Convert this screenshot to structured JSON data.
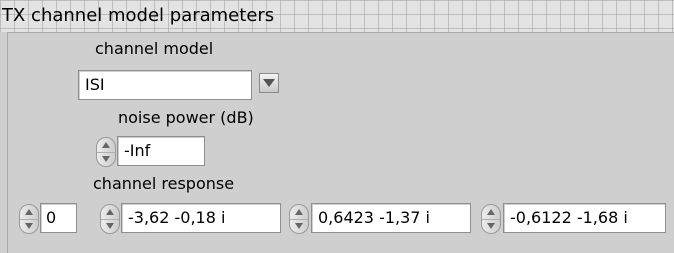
{
  "panel": {
    "title": "TX channel model parameters"
  },
  "channel_model": {
    "label": "channel model",
    "value": "ISI",
    "dropdown_icon": "triangle-down-icon"
  },
  "noise_power": {
    "label": "noise power (dB)",
    "value": "-Inf"
  },
  "channel_response": {
    "label": "channel response",
    "array_index": "0",
    "elements": [
      "-3,62 -0,18 i",
      "0,6423 -1,37 i",
      "-0,6122 -1,68 i"
    ]
  },
  "icons": {
    "spinner": "increment-decrement-icon"
  }
}
